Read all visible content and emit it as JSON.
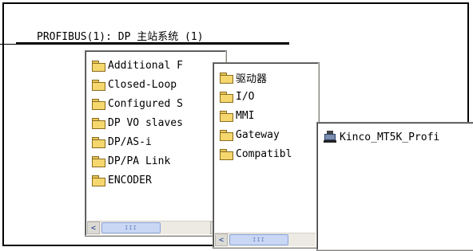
{
  "bus": {
    "label": "PROFIBUS(1): DP 主站系统 (1)"
  },
  "panel1": {
    "items": [
      {
        "label": "Additional F",
        "icon": "folder-icon"
      },
      {
        "label": "Closed-Loop",
        "icon": "folder-icon"
      },
      {
        "label": "Configured S",
        "icon": "folder-icon"
      },
      {
        "label": "DP VO slaves",
        "icon": "folder-icon"
      },
      {
        "label": "DP/AS-i",
        "icon": "folder-icon"
      },
      {
        "label": "DP/PA Link",
        "icon": "folder-icon"
      },
      {
        "label": "ENCODER",
        "icon": "folder-icon"
      }
    ],
    "scroll_left": "<",
    "scroll_right": ">",
    "thumb_grip": "III"
  },
  "panel2": {
    "items": [
      {
        "label": "驱动器",
        "icon": "folder-icon"
      },
      {
        "label": "I/O",
        "icon": "folder-icon"
      },
      {
        "label": "MMI",
        "icon": "folder-icon"
      },
      {
        "label": "Gateway",
        "icon": "folder-icon"
      },
      {
        "label": "Compatibl",
        "icon": "folder-icon"
      }
    ],
    "scroll_left": "<",
    "thumb_grip": "III"
  },
  "panel3": {
    "items": [
      {
        "label": "Kinco_MT5K_Profi",
        "icon": "device-icon"
      }
    ]
  }
}
